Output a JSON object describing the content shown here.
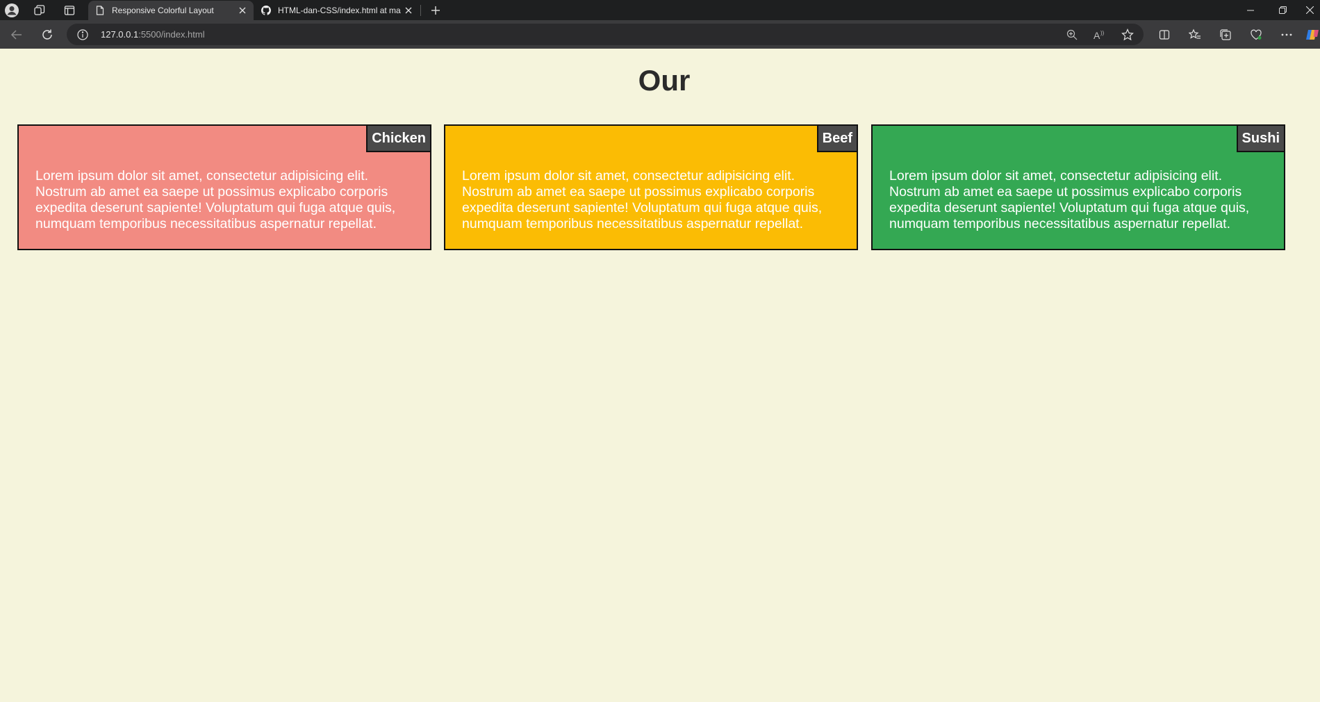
{
  "browser": {
    "tabs": [
      {
        "title": "Responsive Colorful Layout",
        "active": true
      },
      {
        "title": "HTML-dan-CSS/index.html at ma",
        "active": false
      }
    ],
    "url_host": "127.0.0.1",
    "url_rest": ":5500/index.html"
  },
  "page": {
    "heading": "Our",
    "background": "#f5f4dc"
  },
  "cards": [
    {
      "label": "Chicken",
      "color": "#f28b82",
      "text": "Lorem ipsum dolor sit amet, consectetur adipisicing elit. Nostrum ab amet ea saepe ut possimus explicabo corporis expedita deserunt sapiente! Voluptatum qui fuga atque quis, numquam temporibus necessitatibus aspernatur repellat."
    },
    {
      "label": "Beef",
      "color": "#fbbc04",
      "text": "Lorem ipsum dolor sit amet, consectetur adipisicing elit. Nostrum ab amet ea saepe ut possimus explicabo corporis expedita deserunt sapiente! Voluptatum qui fuga atque quis, numquam temporibus necessitatibus aspernatur repellat."
    },
    {
      "label": "Sushi",
      "color": "#34a853",
      "text": "Lorem ipsum dolor sit amet, consectetur adipisicing elit. Nostrum ab amet ea saepe ut possimus explicabo corporis expedita deserunt sapiente! Voluptatum qui fuga atque quis, numquam temporibus necessitatibus aspernatur repellat."
    }
  ]
}
